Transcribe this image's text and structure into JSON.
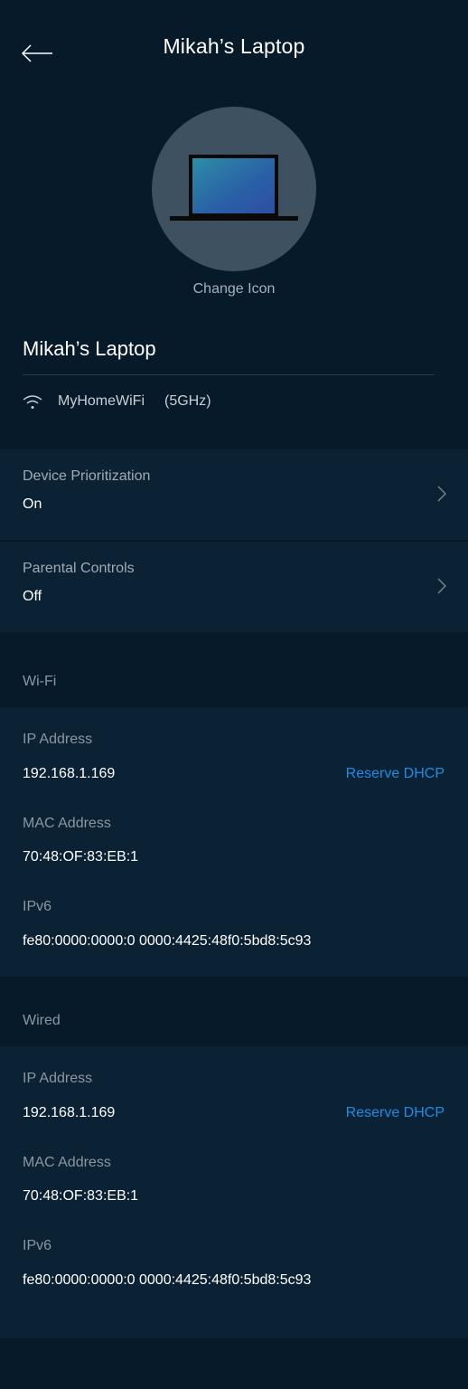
{
  "header": {
    "title": "Mikah’s Laptop",
    "back_icon": "back-arrow-icon"
  },
  "device": {
    "icon": "laptop-icon",
    "change_icon_label": "Change Icon",
    "name": "Mikah’s Laptop",
    "network_name": "MyHomeWiFi",
    "band": "(5GHz)"
  },
  "settings": [
    {
      "label": "Device Prioritization",
      "value": "On"
    },
    {
      "label": "Parental Controls",
      "value": "Off"
    }
  ],
  "sections": [
    {
      "title": "Wi-Fi",
      "ip_label": "IP Address",
      "ip_value": "192.168.1.169",
      "reserve_label": "Reserve DHCP",
      "mac_label": "MAC Address",
      "mac_value": "70:48:OF:83:EB:1",
      "ipv6_label": "IPv6",
      "ipv6_value": "fe80:0000:0000:0 0000:4425:48f0:5bd8:5c93"
    },
    {
      "title": "Wired",
      "ip_label": "IP Address",
      "ip_value": "192.168.1.169",
      "reserve_label": "Reserve DHCP",
      "mac_label": "MAC Address",
      "mac_value": "70:48:OF:83:EB:1",
      "ipv6_label": "IPv6",
      "ipv6_value": "fe80:0000:0000:0 0000:4425:48f0:5bd8:5c93"
    }
  ],
  "colors": {
    "background": "#071a2a",
    "panel": "#0b2234",
    "accent": "#1f8ce6",
    "avatar": "#3e5161"
  }
}
